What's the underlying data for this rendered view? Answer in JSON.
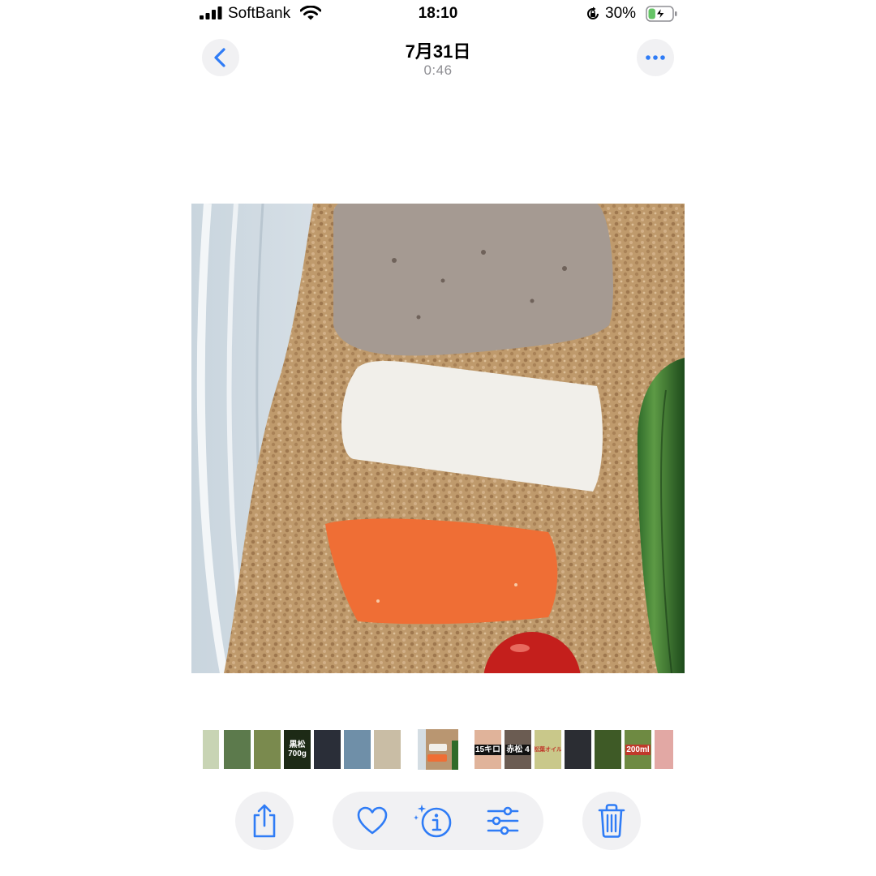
{
  "status_bar": {
    "carrier": "SoftBank",
    "time": "18:10",
    "battery_percent": "30%",
    "battery_level": 0.3,
    "icons": [
      "signal-bars-icon",
      "wifi-icon",
      "rotation-lock-icon",
      "battery-charging-icon"
    ]
  },
  "header": {
    "title": "7月31日",
    "subtitle": "0:46",
    "back_icon": "chevron-left-icon",
    "more_icon": "ellipsis-icon",
    "accent_color": "#2f7cf6"
  },
  "photo": {
    "subject": "rice bran pickles: konjac, daikon radish, carrot, cucumber, cherry tomato in nukadoko"
  },
  "thumbnails": [
    {
      "text": ""
    },
    {
      "text": ""
    },
    {
      "text": ""
    },
    {
      "text": "黒松 700g"
    },
    {
      "text": ""
    },
    {
      "text": ""
    },
    {
      "text": ""
    },
    {
      "text": ""
    },
    {
      "text": "15キロ"
    },
    {
      "text": "赤松 4"
    },
    {
      "text": "松葉オイル"
    },
    {
      "text": ""
    },
    {
      "text": ""
    },
    {
      "text": "200ml"
    },
    {
      "text": ""
    }
  ],
  "toolbar": {
    "icons": [
      "share-icon",
      "favorite-heart-icon",
      "info-sparkle-icon",
      "adjust-sliders-icon",
      "trash-icon"
    ],
    "icon_color": "#2f7cf6"
  }
}
